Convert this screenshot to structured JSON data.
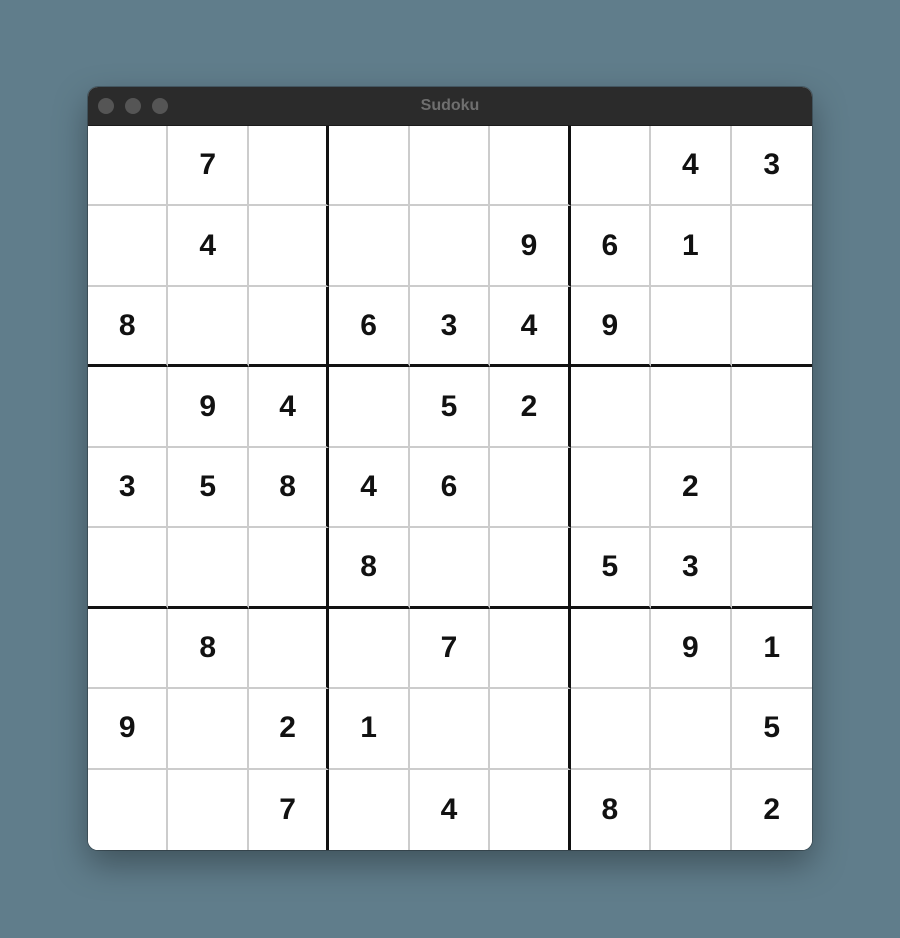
{
  "window": {
    "title": "Sudoku"
  },
  "board": {
    "rows": [
      [
        "",
        "7",
        "",
        "",
        "",
        "",
        "",
        "4",
        "3"
      ],
      [
        "",
        "4",
        "",
        "",
        "",
        "9",
        "6",
        "1",
        ""
      ],
      [
        "8",
        "",
        "",
        "6",
        "3",
        "4",
        "9",
        "",
        ""
      ],
      [
        "",
        "9",
        "4",
        "",
        "5",
        "2",
        "",
        "",
        ""
      ],
      [
        "3",
        "5",
        "8",
        "4",
        "6",
        "",
        "",
        "2",
        ""
      ],
      [
        "",
        "",
        "",
        "8",
        "",
        "",
        "5",
        "3",
        ""
      ],
      [
        "",
        "8",
        "",
        "",
        "7",
        "",
        "",
        "9",
        "1"
      ],
      [
        "9",
        "",
        "2",
        "1",
        "",
        "",
        "",
        "",
        "5"
      ],
      [
        "",
        "",
        "7",
        "",
        "4",
        "",
        "8",
        "",
        "2"
      ]
    ]
  },
  "colors": {
    "desktop": "#607d8b",
    "titlebar": "#2b2b2b",
    "thin_grid": "#cccccc",
    "thick_grid": "#111111",
    "digit": "#111111"
  }
}
